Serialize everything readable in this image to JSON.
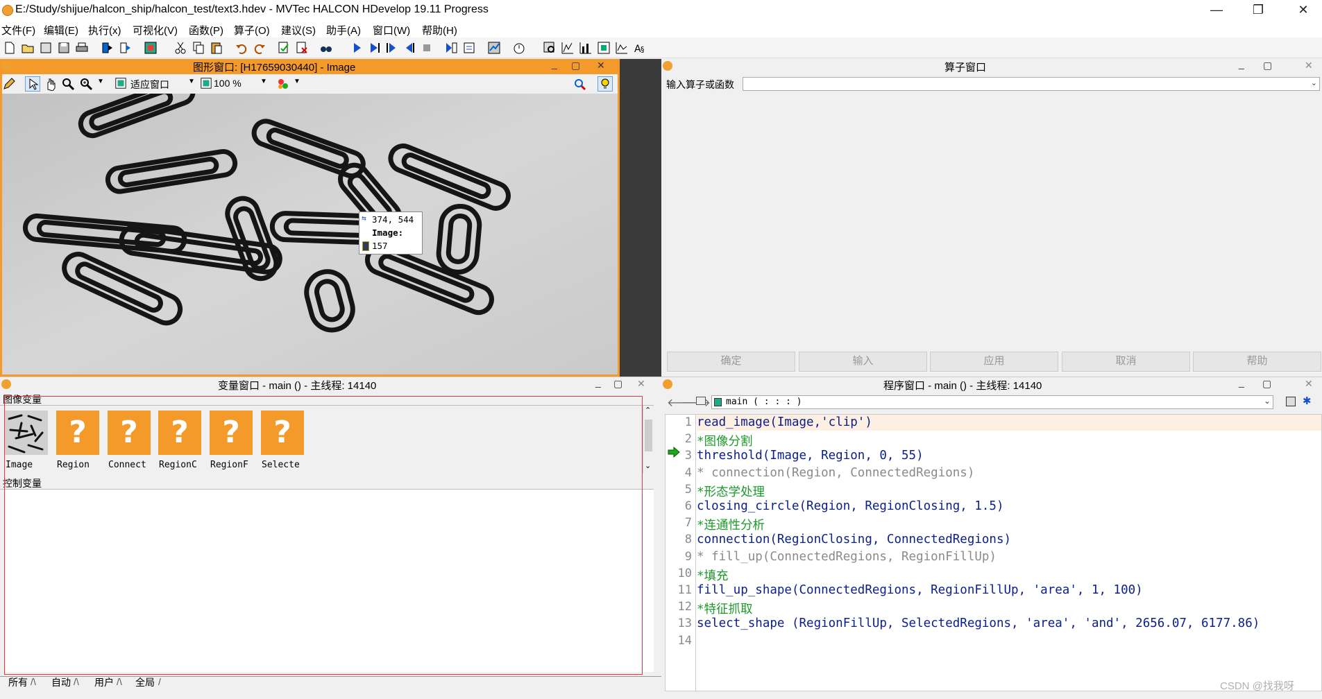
{
  "window": {
    "title": "E:/Study/shijue/halcon_ship/halcon_test/text3.hdev - MVTec HALCON HDevelop 19.11 Progress",
    "minimize": "—",
    "maximize": "❐",
    "close": "✕"
  },
  "menu": [
    "文件(F)",
    "编辑(E)",
    "执行(x)",
    "可视化(V)",
    "函数(P)",
    "算子(O)",
    "建议(S)",
    "助手(A)",
    "窗口(W)",
    "帮助(H)"
  ],
  "graphics_window": {
    "title": "图形窗口: [H17659030440] - Image",
    "fit_label": "适应窗口",
    "zoom_label": "100 %",
    "tooltip": {
      "coords": "374, 544",
      "name": "Image:",
      "value": "157"
    }
  },
  "operator_window": {
    "title": "算子窗口",
    "input_label": "输入算子或函数",
    "buttons": [
      "确定",
      "输入",
      "应用",
      "取消",
      "帮助"
    ]
  },
  "variable_window": {
    "title": "变量窗口 - main () - 主线程: 14140",
    "image_section": "图像变量",
    "control_section": "控制变量",
    "image_vars": [
      "Image",
      "Region",
      "Connect",
      "RegionC",
      "RegionF",
      "Selecte"
    ],
    "tabs": [
      "所有",
      "自动",
      "用户",
      "全局"
    ]
  },
  "program_window": {
    "title": "程序窗口 - main () - 主线程: 14140",
    "procedure": "main ( : : : )",
    "lines": [
      {
        "n": "1",
        "type": "normal",
        "text": "read_image(Image,'clip')"
      },
      {
        "n": "2",
        "type": "cn",
        "text": "*图像分割"
      },
      {
        "n": "3",
        "type": "normal",
        "text": "threshold(Image, Region, 0, 55)"
      },
      {
        "n": "4",
        "type": "comment",
        "text": "* connection(Region, ConnectedRegions)"
      },
      {
        "n": "5",
        "type": "cn",
        "text": "*形态学处理"
      },
      {
        "n": "6",
        "type": "normal",
        "text": "closing_circle(Region, RegionClosing, 1.5)"
      },
      {
        "n": "7",
        "type": "cn",
        "text": "*连通性分析"
      },
      {
        "n": "8",
        "type": "normal",
        "text": "connection(RegionClosing, ConnectedRegions)"
      },
      {
        "n": "9",
        "type": "comment",
        "text": "* fill_up(ConnectedRegions, RegionFillUp)"
      },
      {
        "n": "10",
        "type": "cn",
        "text": "*填充"
      },
      {
        "n": "11",
        "type": "normal",
        "text": "fill_up_shape(ConnectedRegions, RegionFillUp, 'area', 1, 100)"
      },
      {
        "n": "12",
        "type": "cn",
        "text": "*特征抓取"
      },
      {
        "n": "13",
        "type": "normal",
        "text": "select_shape (RegionFillUp, SelectedRegions, 'area', 'and', 2656.07, 6177.86)"
      },
      {
        "n": "14",
        "type": "normal",
        "text": ""
      }
    ],
    "current_line": "3"
  },
  "watermark": "CSDN @找我呀",
  "colors": {
    "accent": "#f39a2a",
    "code": "#0a1e8c",
    "comment": "#8a8a8a",
    "cn_comment": "#1c9a2a"
  }
}
